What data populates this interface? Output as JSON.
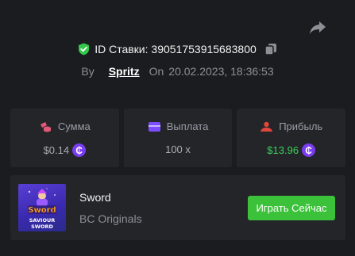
{
  "header": {
    "bet_id_label": "ID Ставки: 39051753915683800",
    "by_label": "By",
    "username": "Spritz",
    "on_label": "On",
    "datetime": "20.02.2023, 18:36:53"
  },
  "stats": [
    {
      "icon": "coins-icon",
      "label": "Сумма",
      "value": "$0.14",
      "coin": "₵",
      "color": "#e05a78"
    },
    {
      "icon": "wallet-icon",
      "label": "Выплата",
      "value": "100 x",
      "color": "#7c4dff"
    },
    {
      "icon": "profit-icon",
      "label": "Прибыль",
      "value": "$13.96",
      "coin": "₵",
      "color": "#e0463c"
    }
  ],
  "game": {
    "thumb_top": "Sword",
    "thumb_bottom_1": "SAVIOUR",
    "thumb_bottom_2": "SWORD",
    "title": "Sword",
    "provider": "BC Originals",
    "play_label": "Играть Сейчас"
  },
  "colors": {
    "background": "#1b1c1f",
    "card": "#232529",
    "accent_green": "#3cc23a",
    "profit_green": "#3dd15a",
    "coin_purple": "#7a3cf0"
  }
}
